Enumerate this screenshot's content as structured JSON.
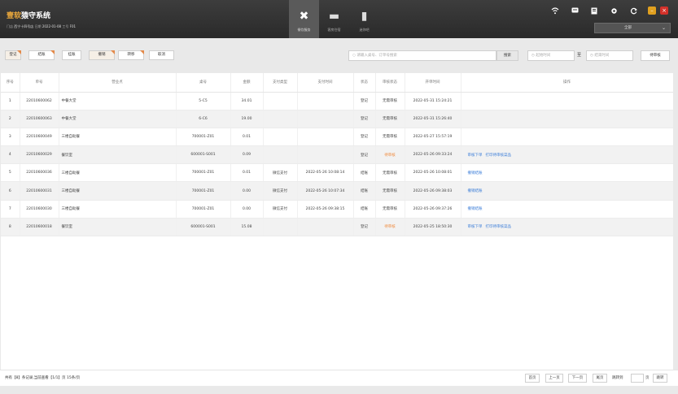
{
  "header": {
    "brand_accent": "壹软",
    "brand_rest": "猿守系统",
    "store_label": "门店",
    "store_value": "西宁十四号店",
    "date_label": "日期",
    "date_value": "2022-01-08",
    "shift_label": "工号",
    "shift_value": "F01",
    "tabs": [
      {
        "label": "餐饮服务",
        "icon": "utensils-icon",
        "glyph": "✖"
      },
      {
        "label": "客房住宿",
        "icon": "bed-icon",
        "glyph": "▬"
      },
      {
        "label": "迷你吧",
        "icon": "bottle-icon",
        "glyph": "▮"
      }
    ],
    "status_icons": [
      "wifi-icon",
      "message-icon",
      "document-icon",
      "settings-icon",
      "refresh-icon"
    ],
    "select_value": "全部"
  },
  "toolbar": {
    "buttons": [
      "登记",
      "结账",
      "挂账",
      "撤销",
      "转移",
      "取消"
    ],
    "search_placeholder": "请输入桌号、订单号搜索",
    "search_button": "搜索",
    "start_date_placeholder": "起始时间",
    "date_separator": "至",
    "end_date_placeholder": "结束时间",
    "pending_button": "待审核"
  },
  "table": {
    "columns": [
      "序号",
      "单号",
      "营业点",
      "桌号",
      "金额",
      "支付类型",
      "支付时间",
      "状态",
      "审核状态",
      "开单时间",
      "操作"
    ],
    "rows": [
      {
        "no": "1",
        "order": "22010600062",
        "venue": "中餐大堂",
        "table": "5-C5",
        "amount": "34.01",
        "pay_type": "",
        "pay_time": "",
        "status": "登记",
        "audit": "无需审核",
        "open_time": "2022-05-31 15:24:21",
        "ops": []
      },
      {
        "no": "2",
        "order": "22010600063",
        "venue": "中餐大堂",
        "table": "6-C6",
        "amount": "19.00",
        "pay_type": "",
        "pay_time": "",
        "status": "登记",
        "audit": "无需审核",
        "open_time": "2022-05-31 15:26:40",
        "ops": []
      },
      {
        "no": "3",
        "order": "22010600049",
        "venue": "三楼自助餐",
        "table": "700001-Z01",
        "amount": "0.01",
        "pay_type": "",
        "pay_time": "",
        "status": "登记",
        "audit": "无需审核",
        "open_time": "2022-05-27 15:57:19",
        "ops": []
      },
      {
        "no": "4",
        "order": "22010600029",
        "venue": "餐饮室",
        "table": "600001-S001",
        "amount": "0.09",
        "pay_type": "",
        "pay_time": "",
        "status": "登记",
        "audit": "待审核",
        "open_time": "2022-05-26 09:33:24",
        "ops": [
          "审核下单",
          "打印待审核菜品"
        ]
      },
      {
        "no": "5",
        "order": "22010600036",
        "venue": "三楼自助餐",
        "table": "700001-Z01",
        "amount": "0.01",
        "pay_type": "微信支付",
        "pay_time": "2022-05-26 10:08:14",
        "status": "结账",
        "audit": "无需审核",
        "open_time": "2022-05-26 10:08:01",
        "ops": [
          "撤销结账"
        ]
      },
      {
        "no": "6",
        "order": "22010600031",
        "venue": "三楼自助餐",
        "table": "700001-Z01",
        "amount": "0.00",
        "pay_type": "微信支付",
        "pay_time": "2022-05-26 10:07:34",
        "status": "结账",
        "audit": "无需审核",
        "open_time": "2022-05-26 09:38:03",
        "ops": [
          "撤销结账"
        ]
      },
      {
        "no": "7",
        "order": "22010600030",
        "venue": "三楼自助餐",
        "table": "700001-Z01",
        "amount": "0.00",
        "pay_type": "微信支付",
        "pay_time": "2022-05-26 09:38:15",
        "status": "结账",
        "audit": "无需审核",
        "open_time": "2022-05-26 09:37:26",
        "ops": [
          "撤销结账"
        ]
      },
      {
        "no": "8",
        "order": "22010600018",
        "venue": "餐饮室",
        "table": "600001-S001",
        "amount": "15.08",
        "pay_type": "",
        "pay_time": "",
        "status": "登记",
        "audit": "待审核",
        "open_time": "2022-05-25 18:50:30",
        "ops": [
          "审核下单",
          "打印待审核菜品"
        ]
      }
    ]
  },
  "footer": {
    "info": "共有【8】条记录,当前查看【1/1】页 15条/页",
    "first": "首页",
    "prev": "上一页",
    "next": "下一页",
    "last": "尾页",
    "jump_label": "跳转到",
    "page_unit": "页",
    "go": "跳转"
  },
  "colors": {
    "accent": "#e9a73c",
    "pending": "#f08a3c",
    "link": "#3b7dd8",
    "close": "#d3312a"
  }
}
